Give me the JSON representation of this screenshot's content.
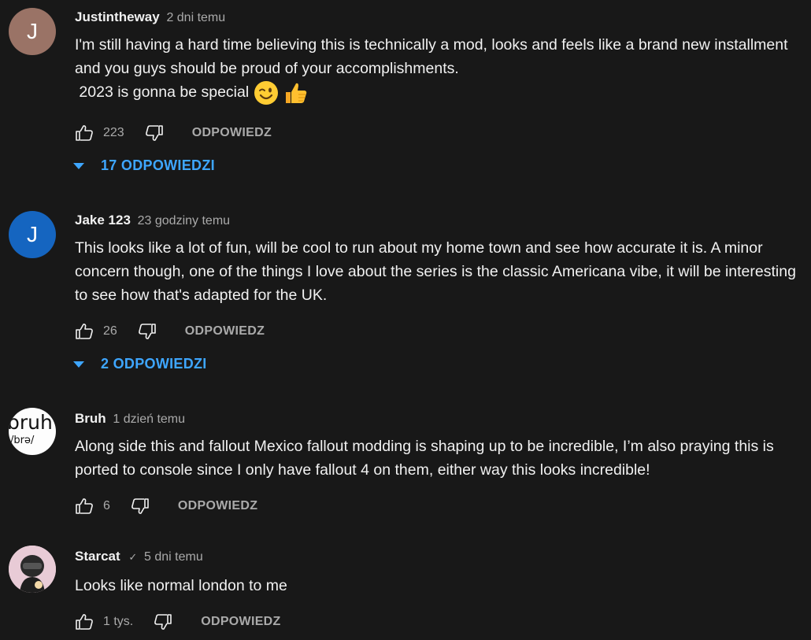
{
  "comments": [
    {
      "avatar_letter": "J",
      "author": "Justintheway",
      "time": "2 dni temu",
      "lines": [
        "I'm still having a hard time believing this is technically a mod, looks and feels like a brand new installment and you guys should be proud of your accomplishments.",
        " 2023 is gonna be special"
      ],
      "emojis": [
        "winking-face",
        "thumbs-up"
      ],
      "likes": "223",
      "reply_label": "ODPOWIEDZ",
      "replies_label": "17 ODPOWIEDZI"
    },
    {
      "avatar_letter": "J",
      "author": "Jake 123",
      "time": "23 godziny temu",
      "lines": [
        "This looks like a lot of fun, will be cool to run about my home town and see how accurate it is. A minor concern though, one of the things I love about the series is the classic Americana vibe, it will be interesting to see how that's adapted for the UK."
      ],
      "likes": "26",
      "reply_label": "ODPOWIEDZ",
      "replies_label": "2 ODPOWIEDZI"
    },
    {
      "avatar_text_big": "bruh",
      "avatar_text_small": "/brə/",
      "author": "Bruh",
      "time": "1 dzień temu",
      "lines": [
        "Along side this and fallout Mexico fallout modding is shaping up to be incredible, I’m also praying this is ported to console since I only have fallout 4 on them, either way this looks incredible!"
      ],
      "likes": "6",
      "reply_label": "ODPOWIEDZ"
    },
    {
      "author": "Starcat",
      "verified_mark": "✓",
      "time": "5 dni temu",
      "lines": [
        "Looks like normal london to me"
      ],
      "likes": "1 tys.",
      "reply_label": "ODPOWIEDZ"
    }
  ],
  "colors": {
    "background": "#181818",
    "text": "#f1f1f1",
    "secondary": "#aaaaaa",
    "link_blue": "#3ea6ff"
  },
  "icons": {
    "like": "thumbs-up-outline-icon",
    "dislike": "thumbs-down-outline-icon",
    "toggle": "caret-down-icon"
  }
}
